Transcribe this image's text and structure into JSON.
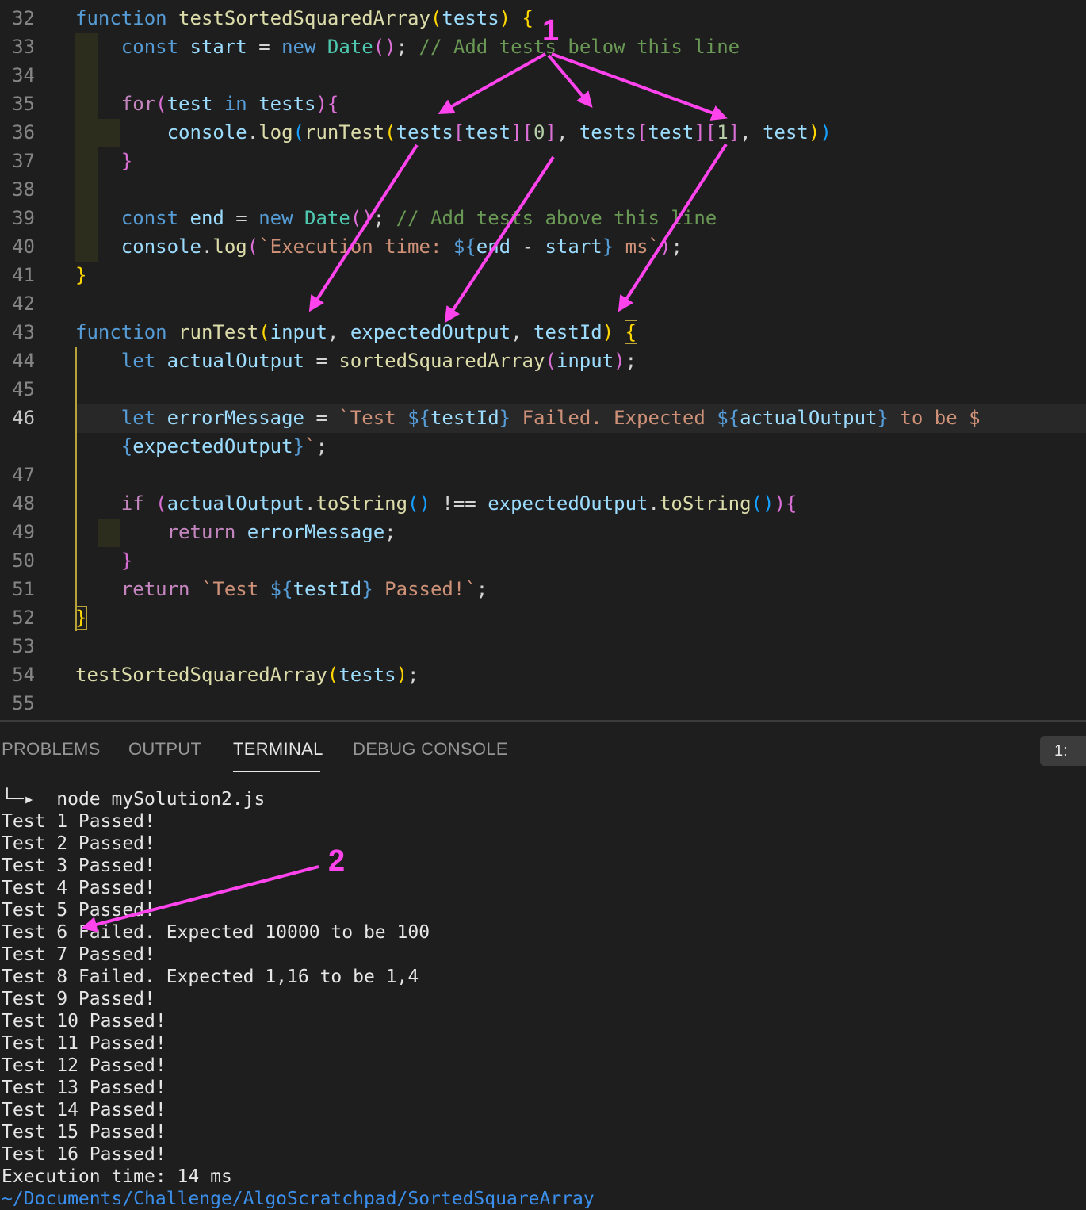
{
  "editor": {
    "line_numbers": [
      "32",
      "33",
      "34",
      "35",
      "36",
      "37",
      "38",
      "39",
      "40",
      "41",
      "42",
      "43",
      "44",
      "45",
      "46",
      "",
      "47",
      "48",
      "49",
      "50",
      "51",
      "52",
      "53",
      "54",
      "55"
    ],
    "current_line": "46",
    "tokens": {
      "function": "function",
      "testSortedSquaredArray": "testSortedSquaredArray",
      "tests": "tests",
      "const": "const",
      "start": "start",
      "end": "end",
      "new": "new",
      "Date": "Date",
      "cmt_below": "// Add tests below this line",
      "cmt_above": "// Add tests above this line",
      "for": "for",
      "test": "test",
      "in": "in",
      "console": "console",
      "log": "log",
      "runTest": "runTest",
      "zero": "0",
      "one": "1",
      "exec_str_a": "`Execution time: ",
      "exec_str_b": " ms`",
      "input": "input",
      "expectedOutput": "expectedOutput",
      "testId": "testId",
      "let": "let",
      "actualOutput": "actualOutput",
      "sortedSquaredArray": "sortedSquaredArray",
      "errorMessage": "errorMessage",
      "err_str_a": "`Test ",
      "err_str_b": " Failed. Expected ",
      "err_str_c": " to be $",
      "err_str_d": "`",
      "if": "if",
      "toString": "toString",
      "return": "return",
      "pass_str_a": "`Test ",
      "pass_str_b": " Passed!`"
    }
  },
  "panel": {
    "tabs": [
      "PROBLEMS",
      "OUTPUT",
      "TERMINAL",
      "DEBUG CONSOLE"
    ],
    "active_tab": "TERMINAL",
    "selector_label": "1:"
  },
  "terminal": {
    "prompt_glyph": "└─▸",
    "command": "node mySolution2.js",
    "output": [
      "Test 1 Passed!",
      "Test 2 Passed!",
      "Test 3 Passed!",
      "Test 4 Passed!",
      "Test 5 Passed!",
      "Test 6 Failed. Expected 10000 to be 100",
      "Test 7 Passed!",
      "Test 8 Failed. Expected 1,16 to be 1,4",
      "Test 9 Passed!",
      "Test 10 Passed!",
      "Test 11 Passed!",
      "Test 12 Passed!",
      "Test 13 Passed!",
      "Test 14 Passed!",
      "Test 15 Passed!",
      "Test 16 Passed!",
      "Execution time: 14 ms"
    ],
    "cwd_partial": "~/Documents/Challenge/AlgoScratchpad/SortedSquareArray"
  },
  "annotations": {
    "label_1": "1",
    "label_2": "2",
    "color": "#ff44ee"
  },
  "colors": {
    "background": "#1e1e1e",
    "keyword": "#569cd6",
    "control": "#c586c0",
    "function": "#dcdcaa",
    "variable": "#9cdcfe",
    "class": "#4ec9b0",
    "string": "#ce9178",
    "comment": "#6a9955"
  }
}
